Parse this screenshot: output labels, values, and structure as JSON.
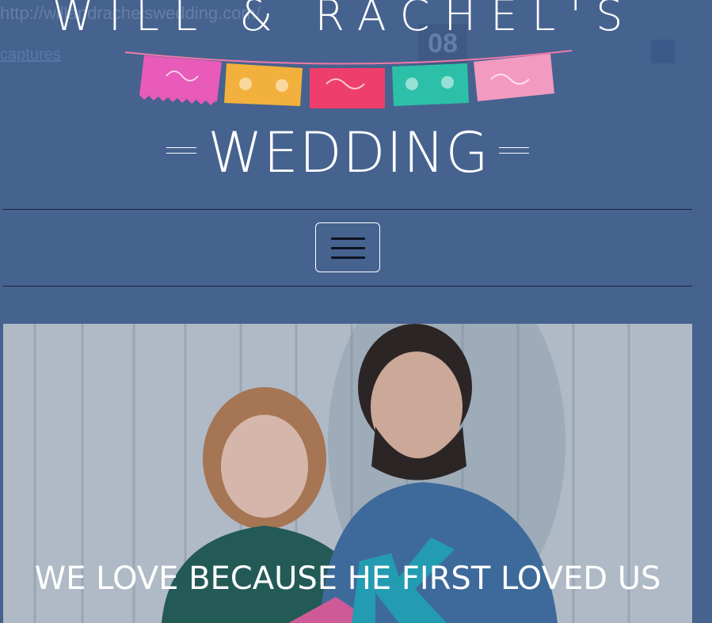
{
  "ghost": {
    "url": "http://willandrachelswedding.com/",
    "captures_link": "captures",
    "calendar_day": "08"
  },
  "site": {
    "title": "WILL & RACHEL'S",
    "subtitle": "WEDDING"
  },
  "banner": {
    "flag_colors": [
      "#e85bb8",
      "#f2b13c",
      "#ee3f6c",
      "#2cc0a8",
      "#f39ac0"
    ],
    "string_color": "#f07aa8"
  },
  "nav": {
    "menu_icon": "hamburger-icon"
  },
  "hero": {
    "caption": "WE LOVE BECAUSE HE FIRST LOVED US",
    "colors": {
      "fence": "#c3cbd0",
      "woman_hair": "#b97a4a",
      "woman_top": "#1f5a4c",
      "man_shirt": "#3f6d9e",
      "man_hair": "#2a1c14",
      "letter_k": "#1fa7b8",
      "pink_letter": "#e85a9a"
    }
  }
}
